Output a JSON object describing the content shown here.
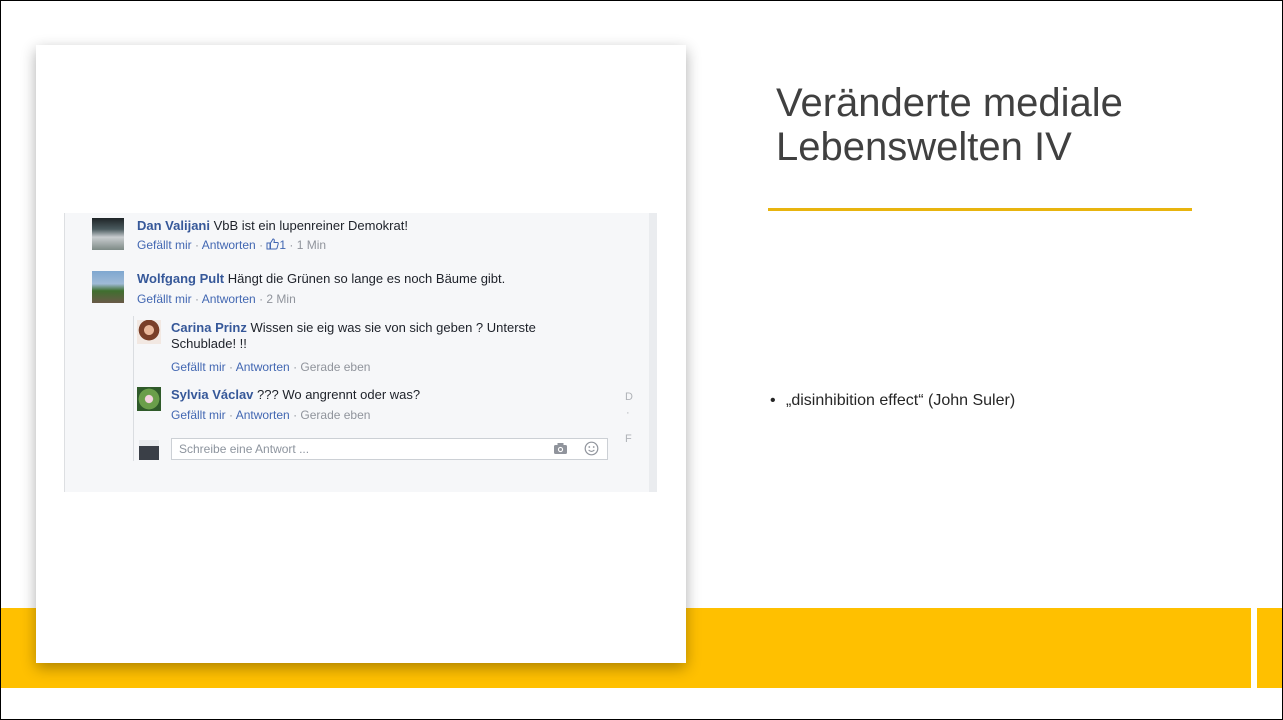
{
  "slide": {
    "title": "Veränderte mediale Lebenswelten IV",
    "bullet": "„disinhibition effect“ (John Suler)",
    "bullet_marker": "•",
    "accent_color": "#FFC000"
  },
  "screenshot": {
    "comments": [
      {
        "author": "Dan Valijani",
        "text": " VbB ist ein lupenreiner Demokrat!",
        "like": "Gefällt mir",
        "reply": "Antworten",
        "sep": " · ",
        "likes": "1",
        "time": " · 1 Min"
      },
      {
        "author": "Wolfgang Pult",
        "text": " Hängt die Grünen so lange es noch Bäume gibt.",
        "like": "Gefällt mir",
        "reply": "Antworten",
        "sep": " · ",
        "time": " · 2 Min"
      }
    ],
    "replies": [
      {
        "author": "Carina Prinz",
        "text": " Wissen sie eig was sie von sich geben ? Unterste Schublade! !!",
        "like": "Gefällt mir",
        "reply": "Antworten",
        "sep": " · ",
        "time": " · Gerade eben"
      },
      {
        "author": "Sylvia Václav",
        "text": " ??? Wo angrennt oder was?",
        "like": "Gefällt mir",
        "reply": "Antworten",
        "sep": " · ",
        "time": " · Gerade eben"
      }
    ],
    "reply_input": {
      "placeholder": "Schreibe eine Antwort ..."
    },
    "icons": {
      "camera": "camera-icon",
      "emoji": "emoji-icon",
      "thumb": "thumbs-up-icon"
    },
    "side_fragments": [
      "D",
      "·",
      "F"
    ]
  }
}
